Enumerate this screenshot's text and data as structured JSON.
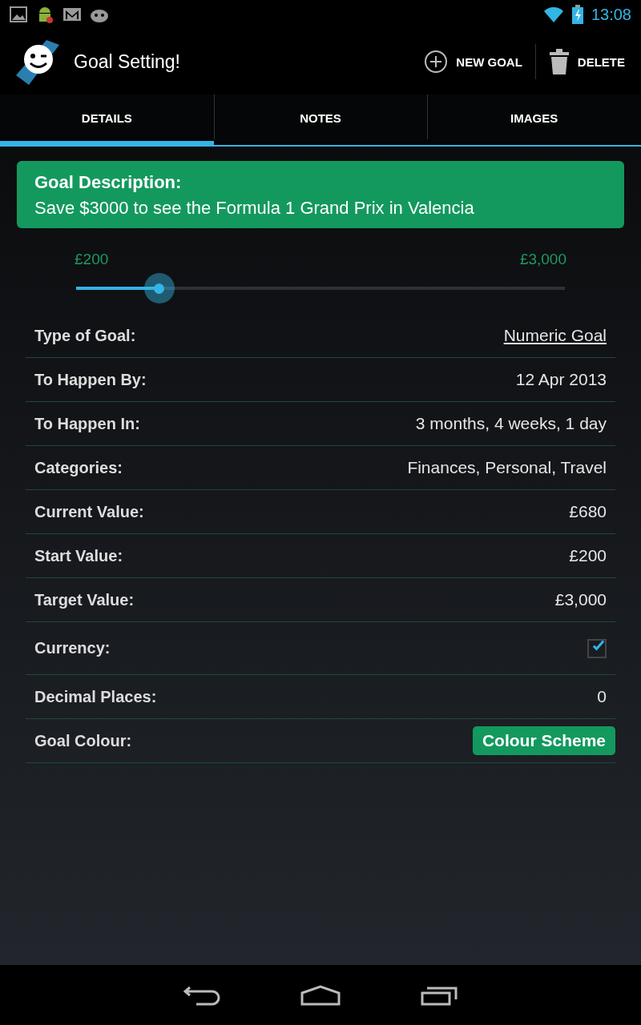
{
  "status_bar": {
    "time": "13:08"
  },
  "action_bar": {
    "title": "Goal Setting!",
    "actions": [
      {
        "label": "NEW GOAL",
        "kind": "add"
      },
      {
        "label": "DELETE",
        "kind": "delete"
      }
    ]
  },
  "tabs": [
    {
      "label": "DETAILS",
      "selected": true
    },
    {
      "label": "NOTES",
      "selected": false
    },
    {
      "label": "IMAGES",
      "selected": false
    }
  ],
  "goal_card": {
    "heading": "Goal Description:",
    "description": "Save $3000 to see the Formula 1 Grand Prix in Valencia"
  },
  "progress": {
    "min_label": "£200",
    "max_label": "£3,000",
    "level": 0.17
  },
  "fields": [
    {
      "label": "Type of Goal:",
      "kind": "link",
      "value": "Numeric Goal"
    },
    {
      "label": "To Happen By:",
      "kind": "text",
      "value": "12 Apr 2013"
    },
    {
      "label": "To Happen In:",
      "kind": "text",
      "value": "3 months, 4 weeks, 1 day"
    },
    {
      "label": "Categories:",
      "kind": "text",
      "value": "Finances, Personal, Travel"
    },
    {
      "label": "Current Value:",
      "kind": "text",
      "value": "£680"
    },
    {
      "label": "Start Value:",
      "kind": "text",
      "value": "£200"
    },
    {
      "label": "Target Value:",
      "kind": "text",
      "value": "£3,000"
    },
    {
      "label": "Currency:",
      "kind": "checkbox",
      "checked": true
    },
    {
      "label": "Decimal Places:",
      "kind": "text",
      "value": "0"
    },
    {
      "label": "Goal Colour:",
      "kind": "button",
      "value": "Colour Scheme"
    }
  ]
}
